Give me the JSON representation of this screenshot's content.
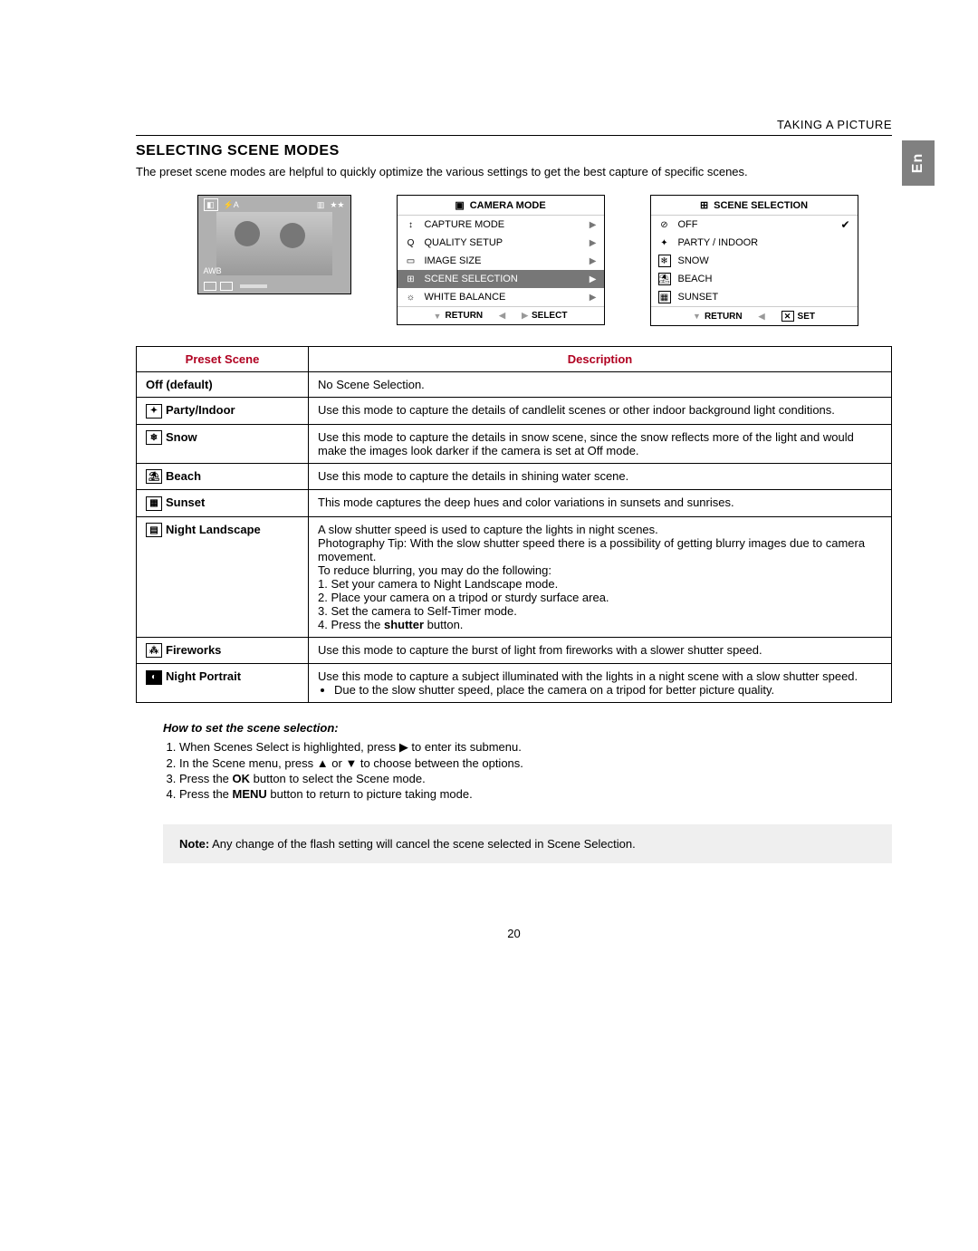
{
  "header": {
    "breadcrumb": "TAKING A PICTURE"
  },
  "lang_tab": "En",
  "title": "SELECTING SCENE MODES",
  "intro": "The preset scene modes are helpful to quickly optimize the various settings to get the best capture of specific scenes.",
  "photo": {
    "awb": "AWB",
    "stars": "★★"
  },
  "menu1": {
    "title": "CAMERA MODE",
    "items": [
      {
        "icon": "↕",
        "label": "CAPTURE MODE"
      },
      {
        "icon": "Q",
        "label": "QUALITY SETUP"
      },
      {
        "icon": "▭",
        "label": "IMAGE SIZE"
      },
      {
        "icon": "⊞",
        "label": "SCENE SELECTION",
        "selected": true
      },
      {
        "icon": "☼",
        "label": "WHITE BALANCE"
      }
    ],
    "foot_return": "RETURN",
    "foot_select": "SELECT"
  },
  "menu2": {
    "title": "SCENE  SELECTION",
    "items": [
      {
        "icon": "⊘",
        "label": "OFF",
        "checked": true
      },
      {
        "icon": "✦",
        "label": "PARTY / INDOOR"
      },
      {
        "icon": "❄",
        "label": "SNOW"
      },
      {
        "icon": "⛱",
        "label": "BEACH"
      },
      {
        "icon": "▦",
        "label": "SUNSET"
      }
    ],
    "foot_return": "RETURN",
    "foot_set": "SET"
  },
  "table": {
    "head_preset": "Preset Scene",
    "head_desc": "Description",
    "rows": {
      "off": {
        "label": "Off (default)",
        "desc": "No Scene Selection."
      },
      "party": {
        "label": "Party/Indoor",
        "desc": "Use this mode to capture the details of candlelit scenes or other indoor background light conditions."
      },
      "snow": {
        "label": "Snow",
        "desc": "Use this mode to capture the details in snow scene, since the snow reflects more of the light and would make the images look darker if the camera is set at Off mode."
      },
      "beach": {
        "label": "Beach",
        "desc": "Use this mode to capture the details in shining water scene."
      },
      "sunset": {
        "label": "Sunset",
        "desc": "This mode captures the deep hues and color variations in sunsets and sunrises."
      },
      "night_landscape": {
        "label": "Night Landscape",
        "l1": "A slow shutter speed is used to capture the lights in night scenes.",
        "l2": "Photography Tip: With the slow shutter speed there is a possibility of getting blurry  images due to camera movement.",
        "l3": "To reduce blurring, you may do the following:",
        "l4": "1. Set your camera to Night Landscape mode.",
        "l5": "2. Place your camera on a tripod or sturdy surface area.",
        "l6": "3. Set the camera to Self-Timer mode.",
        "l7a": "4. Press the ",
        "l7b": "shutter",
        "l7c": " button."
      },
      "fireworks": {
        "label": "Fireworks",
        "desc": "Use this mode to capture the burst of light from fireworks with a slower shutter speed."
      },
      "night_portrait": {
        "label": "Night Portrait",
        "l1": "Use this mode to capture a subject illuminated with the lights in a night scene with a slow shutter speed.",
        "l2": "Due to the slow shutter speed, place the camera on a tripod for better picture quality."
      }
    }
  },
  "howto": {
    "title": "How to set the scene selection:",
    "s1a": "When Scenes Select is highlighted, press ",
    "s1b": "  to enter its submenu.",
    "s2a": "In the Scene menu, press ",
    "s2b": "  or ",
    "s2c": "  to choose between the options.",
    "s3a": "Press the ",
    "s3b": "OK",
    "s3c": " button to select the Scene mode.",
    "s4a": "Press the ",
    "s4b": "MENU",
    "s4c": " button to return to picture taking mode."
  },
  "note": {
    "label": "Note:",
    "text": " Any change of the flash setting will cancel the scene selected in Scene Selection."
  },
  "arrows": {
    "right": "▶",
    "up": "▲",
    "down": "▼"
  },
  "page_number": "20"
}
